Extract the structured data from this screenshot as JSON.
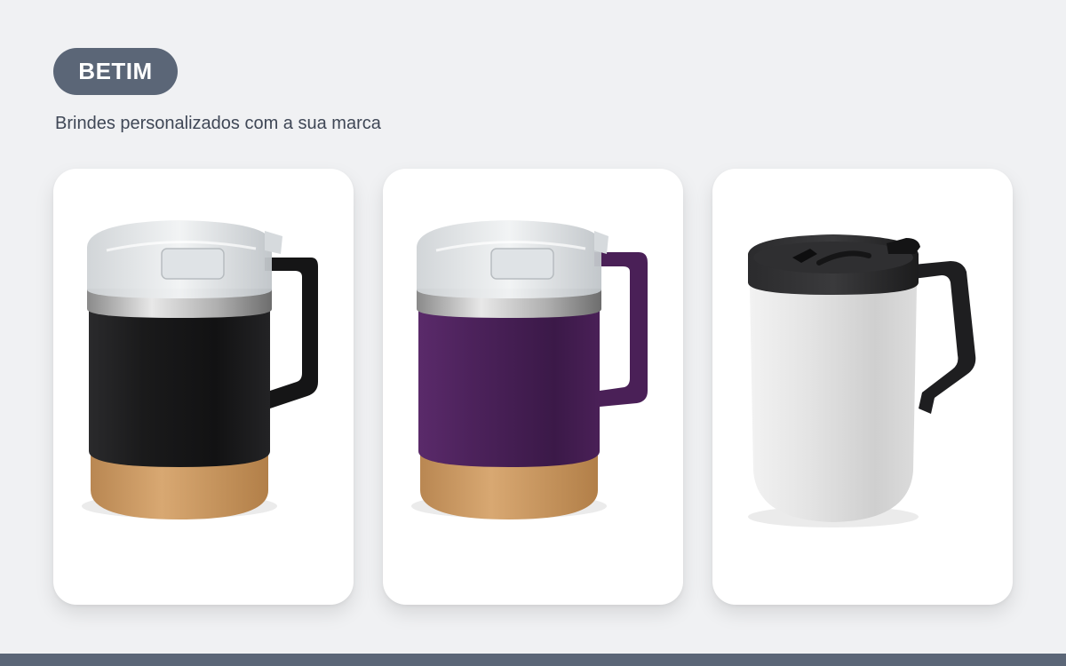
{
  "header": {
    "badge_label": "BETIM",
    "subtitle": "Brindes personalizados com a sua marca"
  },
  "products": [
    {
      "name": "black-cork-mug",
      "body_color": "#1c1c1e",
      "accent": "cork base"
    },
    {
      "name": "purple-cork-mug",
      "body_color": "#4a2057",
      "accent": "cork base"
    },
    {
      "name": "white-travel-mug",
      "body_color": "#e6e6e6",
      "accent": "black lid"
    }
  ],
  "colors": {
    "background": "#f0f1f3",
    "badge": "#5b6677",
    "card": "#ffffff",
    "cork": "#c9955a"
  }
}
